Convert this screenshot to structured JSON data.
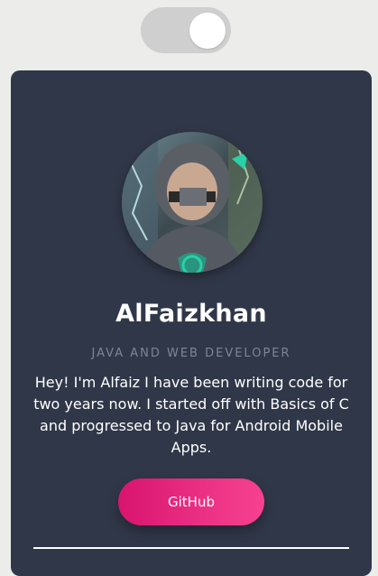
{
  "theme_toggle": {
    "state": "on"
  },
  "profile": {
    "name": "AlFaizkhan",
    "role": "JAVA AND WEB DEVELOPER",
    "bio": "Hey! I'm Alfaiz I have been writing code for two years now. I started off with Basics of C and progressed to Java for Android Mobile Apps.",
    "github_label": "GitHub"
  },
  "colors": {
    "page_bg": "#ececea",
    "card_bg": "#303748",
    "accent": "#e62a7f",
    "toggle_track": "#cfcfcf"
  }
}
